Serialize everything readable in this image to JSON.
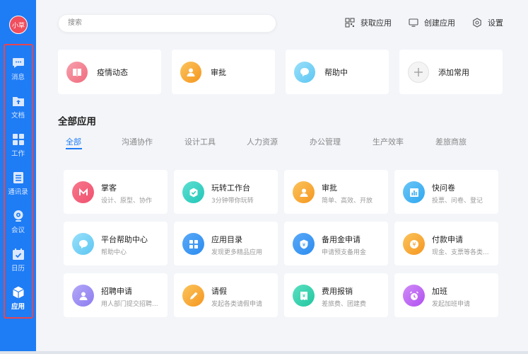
{
  "sidebar": {
    "avatar_text": "小草",
    "items": [
      {
        "label": "消息",
        "icon": "message-icon"
      },
      {
        "label": "文档",
        "icon": "folder-upload-icon"
      },
      {
        "label": "工作",
        "icon": "grid-icon"
      },
      {
        "label": "通讯录",
        "icon": "contacts-icon"
      },
      {
        "label": "会议",
        "icon": "webcam-icon"
      },
      {
        "label": "日历",
        "icon": "calendar-icon"
      },
      {
        "label": "应用",
        "icon": "cube-icon",
        "active": true
      }
    ],
    "colors": {
      "bg": "#1e7cf5",
      "highlight_frame": "#e8454f"
    }
  },
  "header": {
    "search_placeholder": "搜索",
    "links": [
      {
        "label": "获取应用",
        "icon": "apps-grid-icon"
      },
      {
        "label": "创建应用",
        "icon": "monitor-icon"
      },
      {
        "label": "设置",
        "icon": "gear-icon"
      }
    ]
  },
  "quick_access": [
    {
      "label": "疫情动态",
      "icon": "book-icon",
      "color": "#f06b7d"
    },
    {
      "label": "审批",
      "icon": "person-icon",
      "color": "#f7a52b"
    },
    {
      "label": "帮助中",
      "icon": "chat-bubble-icon",
      "color": "#5cc6f2"
    },
    {
      "label": "添加常用",
      "icon": "plus-icon",
      "color": "#eeeeee"
    }
  ],
  "all_apps": {
    "title": "全部应用",
    "tabs": [
      "全部",
      "沟通协作",
      "设计工具",
      "人力资源",
      "办公管理",
      "生产效率",
      "差旅商旅"
    ],
    "active_tab": "全部",
    "apps": [
      {
        "title": "掌客",
        "subtitle": "设计、原型、协作",
        "icon": "m-logo-icon",
        "color": "#f0506e"
      },
      {
        "title": "玩转工作台",
        "subtitle": "3分钟带你玩转",
        "icon": "check-badge-icon",
        "color": "#22c6b8"
      },
      {
        "title": "审批",
        "subtitle": "简单、高效、开放",
        "icon": "person-icon",
        "color": "#f7a52b"
      },
      {
        "title": "快问卷",
        "subtitle": "投票、问卷、登记",
        "icon": "bar-chart-icon",
        "color": "#2ea7f0"
      },
      {
        "title": "平台帮助中心",
        "subtitle": "帮助中心",
        "icon": "chat-bubble-icon",
        "color": "#5cc6f2"
      },
      {
        "title": "应用目录",
        "subtitle": "发现更多精品应用",
        "icon": "grid-icon",
        "color": "#2b8cf0"
      },
      {
        "title": "备用金申请",
        "subtitle": "申请预支备用金",
        "icon": "wallet-icon",
        "color": "#2b8cf0"
      },
      {
        "title": "付款申请",
        "subtitle": "现金、支票等各类...",
        "icon": "yen-icon",
        "color": "#f7a52b"
      },
      {
        "title": "招聘申请",
        "subtitle": "用人部门提交招聘...",
        "icon": "user-add-icon",
        "color": "#8c7cf0"
      },
      {
        "title": "请假",
        "subtitle": "发起各类请假申请",
        "icon": "pencil-icon",
        "color": "#f7a52b"
      },
      {
        "title": "费用报销",
        "subtitle": "差旅费、团建费",
        "icon": "receipt-icon",
        "color": "#22c6a0"
      },
      {
        "title": "加班",
        "subtitle": "发起加班申请",
        "icon": "alarm-clock-icon",
        "color": "#b04ff0"
      }
    ]
  }
}
